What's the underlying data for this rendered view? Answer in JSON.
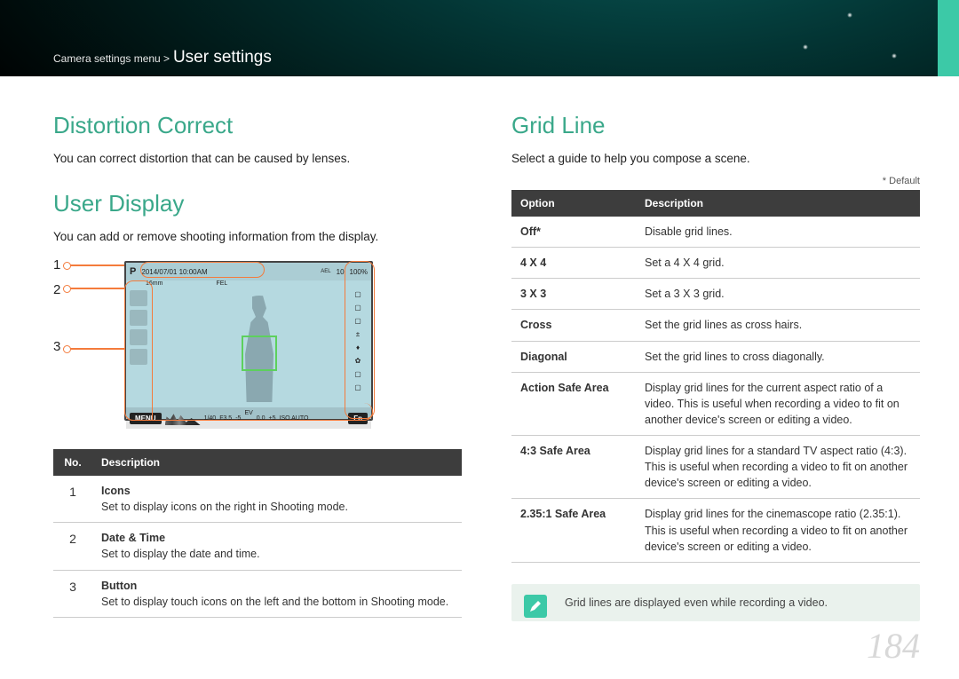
{
  "breadcrumb": {
    "path": "Camera settings menu >",
    "current": "User settings"
  },
  "page_number": "184",
  "left": {
    "section1": {
      "title": "Distortion Correct",
      "intro": "You can correct distortion that can be caused by lenses."
    },
    "section2": {
      "title": "User Display",
      "intro": "You can add or remove shooting information from the display.",
      "callouts": [
        "1",
        "2",
        "3"
      ],
      "lcd": {
        "mode": "P",
        "datetime": "2014/07/01 10:00AM",
        "lens": "16mm",
        "ael": "AEL",
        "fel": "FEL",
        "count": "10",
        "battery": "100%",
        "menu": "MENU",
        "fn": "Fn",
        "shutter": "1/40",
        "aperture": "F3.5",
        "ev_label": "EV",
        "ev_scale_low": "-5",
        "ev_scale_mid": "0.0",
        "ev_scale_hi": "+5",
        "iso": "ISO AUTO"
      },
      "table": {
        "headers": {
          "no": "No.",
          "desc": "Description"
        },
        "rows": [
          {
            "no": "1",
            "title": "Icons",
            "desc": "Set to display icons on the right in Shooting mode."
          },
          {
            "no": "2",
            "title": "Date & Time",
            "desc": "Set to display the date and time."
          },
          {
            "no": "3",
            "title": "Button",
            "desc": "Set to display touch icons on the left and the bottom in Shooting mode."
          }
        ]
      }
    }
  },
  "right": {
    "section": {
      "title": "Grid Line",
      "intro": "Select a guide to help you compose a scene.",
      "default_note": "* Default",
      "table": {
        "headers": {
          "opt": "Option",
          "desc": "Description"
        },
        "rows": [
          {
            "opt": "Off*",
            "desc": "Disable grid lines."
          },
          {
            "opt": "4 X 4",
            "desc": "Set a 4 X 4 grid."
          },
          {
            "opt": "3 X 3",
            "desc": "Set a 3 X 3 grid."
          },
          {
            "opt": "Cross",
            "desc": "Set the grid lines as cross hairs."
          },
          {
            "opt": "Diagonal",
            "desc": "Set the grid lines to cross diagonally."
          },
          {
            "opt": "Action Safe Area",
            "desc": "Display grid lines for the current aspect ratio of a video. This is useful when recording a video to fit on another device's screen or editing a video."
          },
          {
            "opt": "4:3 Safe Area",
            "desc": "Display grid lines for a standard TV aspect ratio (4:3). This is useful when recording a video to fit on another device's screen or editing a video."
          },
          {
            "opt": "2.35:1 Safe Area",
            "desc": "Display grid lines for the cinemascope ratio (2.35:1). This is useful when recording a video to fit on another device's screen or editing a video."
          }
        ]
      },
      "note": "Grid lines are displayed even while recording a video."
    }
  }
}
